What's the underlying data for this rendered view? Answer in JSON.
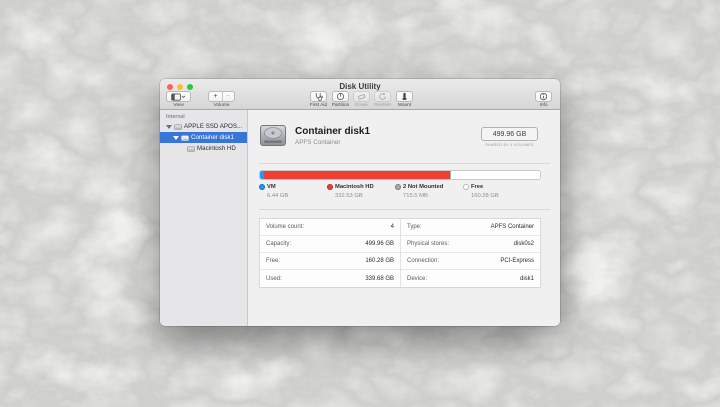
{
  "window": {
    "title": "Disk Utility"
  },
  "toolbar": {
    "view_label": "View",
    "volume_label": "Volume",
    "volume_add": "+",
    "volume_remove": "−",
    "actions": [
      {
        "label": "First Aid",
        "enabled": true
      },
      {
        "label": "Partition",
        "enabled": true
      },
      {
        "label": "Erase",
        "enabled": false
      },
      {
        "label": "Restore",
        "enabled": false
      },
      {
        "label": "Mount",
        "enabled": true
      }
    ],
    "info_label": "Info"
  },
  "sidebar": {
    "section": "Internal",
    "items": [
      {
        "label": "APPLE SSD APOS...",
        "selected": false
      },
      {
        "label": "Container disk1",
        "selected": true
      },
      {
        "label": "Macintosh HD",
        "selected": false
      }
    ]
  },
  "main": {
    "title": "Container disk1",
    "subtitle": "APFS Container",
    "size": "499.96 GB",
    "size_note": "SHARED BY 4 VOLUMES"
  },
  "usage": {
    "segments": [
      {
        "name": "VM",
        "value": "6.44 GB",
        "color": "#169df6",
        "pct": 1.3
      },
      {
        "name": "Macintosh HD",
        "value": "332.53 GB",
        "color": "#ef3e33",
        "pct": 66.5
      },
      {
        "name": "2 Not Mounted",
        "value": "715.5 MB",
        "color": "#a9a9a9",
        "pct": 0.4
      },
      {
        "name": "Free",
        "value": "160.28 GB",
        "color": "#ffffff",
        "pct": 31.8
      }
    ]
  },
  "details": {
    "left": [
      {
        "label": "Volume count:",
        "value": "4"
      },
      {
        "label": "Capacity:",
        "value": "499.96 GB"
      },
      {
        "label": "Free:",
        "value": "160.28 GB"
      },
      {
        "label": "Used:",
        "value": "339.68 GB"
      }
    ],
    "right": [
      {
        "label": "Type:",
        "value": "APFS Container"
      },
      {
        "label": "Physical stores:",
        "value": "disk0s2"
      },
      {
        "label": "Connection:",
        "value": "PCI-Express"
      },
      {
        "label": "Device:",
        "value": "disk1"
      }
    ]
  }
}
